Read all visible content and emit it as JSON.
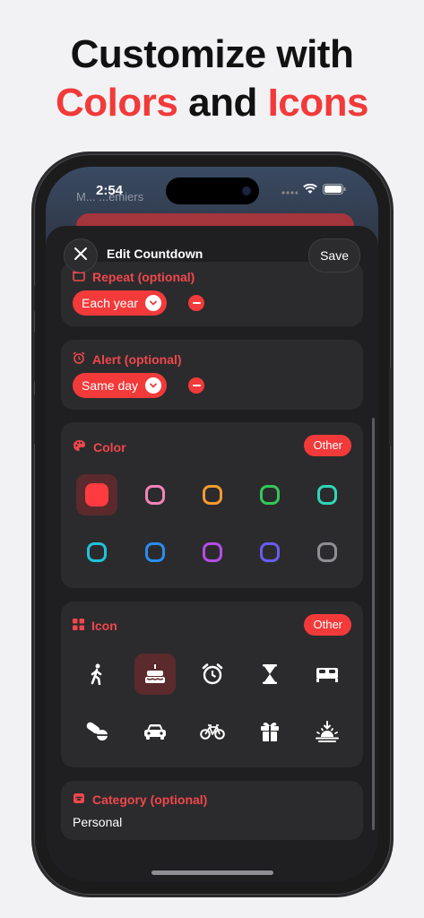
{
  "headline": {
    "line1": "Customize with",
    "word_colors": "Colors",
    "word_and": "and",
    "word_icons": "Icons"
  },
  "status_bar": {
    "time": "2:54"
  },
  "background_app": {
    "peek_text": "M... ...emiers"
  },
  "nav": {
    "title": "Edit Countdown",
    "save_label": "Save",
    "close_icon": "close-icon"
  },
  "repeat": {
    "label": "Repeat (optional)",
    "value": "Each year",
    "icon": "calendar-icon"
  },
  "alert": {
    "label": "Alert (optional)",
    "value": "Same day",
    "icon": "alarm-icon"
  },
  "color_section": {
    "label": "Color",
    "other_label": "Other",
    "icon": "palette-icon",
    "selected_index": 0,
    "swatches": [
      "#ff3b40",
      "#f283b8",
      "#f39a30",
      "#34c759",
      "#2fd6b6",
      "#20c3d9",
      "#2a8cf0",
      "#b44ee6",
      "#6a5cf2",
      "#8e8e93"
    ]
  },
  "icon_section": {
    "label": "Icon",
    "other_label": "Other",
    "icon": "grid-icon",
    "selected_index": 1,
    "icons": [
      "walking-figure-icon",
      "birthday-cake-icon",
      "alarm-clock-icon",
      "hourglass-icon",
      "bed-icon",
      "pills-icon",
      "car-icon",
      "bicycle-icon",
      "gift-icon",
      "sunset-icon"
    ]
  },
  "category": {
    "label": "Category (optional)",
    "value": "Personal",
    "icon": "tray-icon"
  },
  "colors": {
    "accent": "#f23a3a",
    "card": "#2b2b2d",
    "sheet": "#1f1f21"
  }
}
